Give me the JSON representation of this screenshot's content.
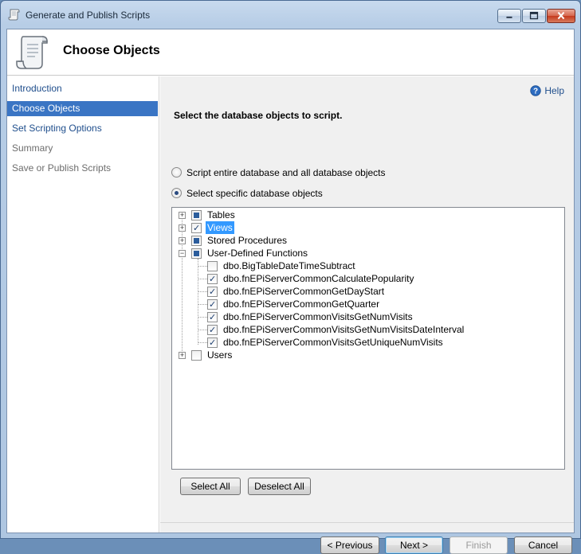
{
  "window": {
    "title": "Generate and Publish Scripts",
    "minimize_icon": "minimize-icon",
    "maximize_icon": "maximize-icon",
    "close_icon": "close-icon"
  },
  "header": {
    "title": "Choose Objects",
    "icon": "scroll-icon"
  },
  "sidebar": {
    "items": [
      {
        "label": "Introduction",
        "state": "link"
      },
      {
        "label": "Choose Objects",
        "state": "active"
      },
      {
        "label": "Set Scripting Options",
        "state": "link"
      },
      {
        "label": "Summary",
        "state": "disabled"
      },
      {
        "label": "Save or Publish Scripts",
        "state": "disabled"
      }
    ]
  },
  "main": {
    "help_label": "Help",
    "prompt": "Select the database objects to script.",
    "radio_entire": "Script entire database and all database objects",
    "radio_specific": "Select specific database objects",
    "tree": {
      "tables": "Tables",
      "views": "Views",
      "stored_procedures": "Stored Procedures",
      "udf": "User-Defined Functions",
      "udf_children": [
        "dbo.BigTableDateTimeSubtract",
        "dbo.fnEPiServerCommonCalculatePopularity",
        "dbo.fnEPiServerCommonGetDayStart",
        "dbo.fnEPiServerCommonGetQuarter",
        "dbo.fnEPiServerCommonVisitsGetNumVisits",
        "dbo.fnEPiServerCommonVisitsGetNumVisitsDateInterval",
        "dbo.fnEPiServerCommonVisitsGetUniqueNumVisits"
      ],
      "users": "Users"
    },
    "select_all": "Select All",
    "deselect_all": "Deselect All"
  },
  "footer": {
    "previous": "< Previous",
    "next": "Next >",
    "finish": "Finish",
    "cancel": "Cancel"
  },
  "colors": {
    "accent": "#3a75c4",
    "link": "#1f4e8c",
    "selection": "#3399ff"
  }
}
